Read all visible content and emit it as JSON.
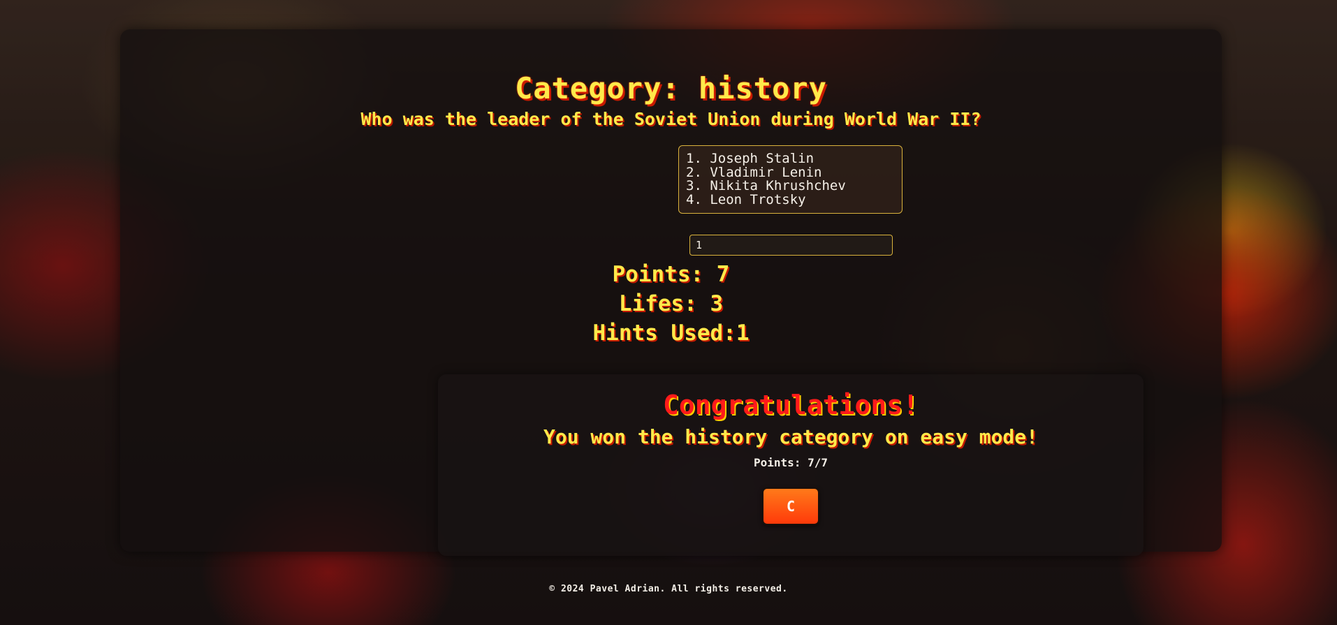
{
  "header": {
    "category_title": "Category: history",
    "question": "Who was the leader of the Soviet Union during World War II?"
  },
  "options": [
    "1. Joseph Stalin",
    "2. Vladimir Lenin",
    "3. Nikita Khrushchev",
    "4. Leon Trotsky"
  ],
  "answer_input": {
    "value": "1"
  },
  "stats": {
    "points": "Points: 7",
    "lifes": "Lifes: 3",
    "hints": "Hints Used:1"
  },
  "result": {
    "congrats": "Congratulations!",
    "message": "You won the history category on easy mode!",
    "points": "Points: 7/7",
    "restart_icon": "restart-icon",
    "restart_glyph": "C"
  },
  "footer": {
    "text": "© 2024 Pavel Adrian. All rights reserved."
  },
  "colors": {
    "title_yellow": "#ffe94a",
    "shadow_red": "#c41a00",
    "congrats_red": "#ff1a1a",
    "button_orange": "#ff5a14",
    "border_gold": "#d9b23c"
  }
}
